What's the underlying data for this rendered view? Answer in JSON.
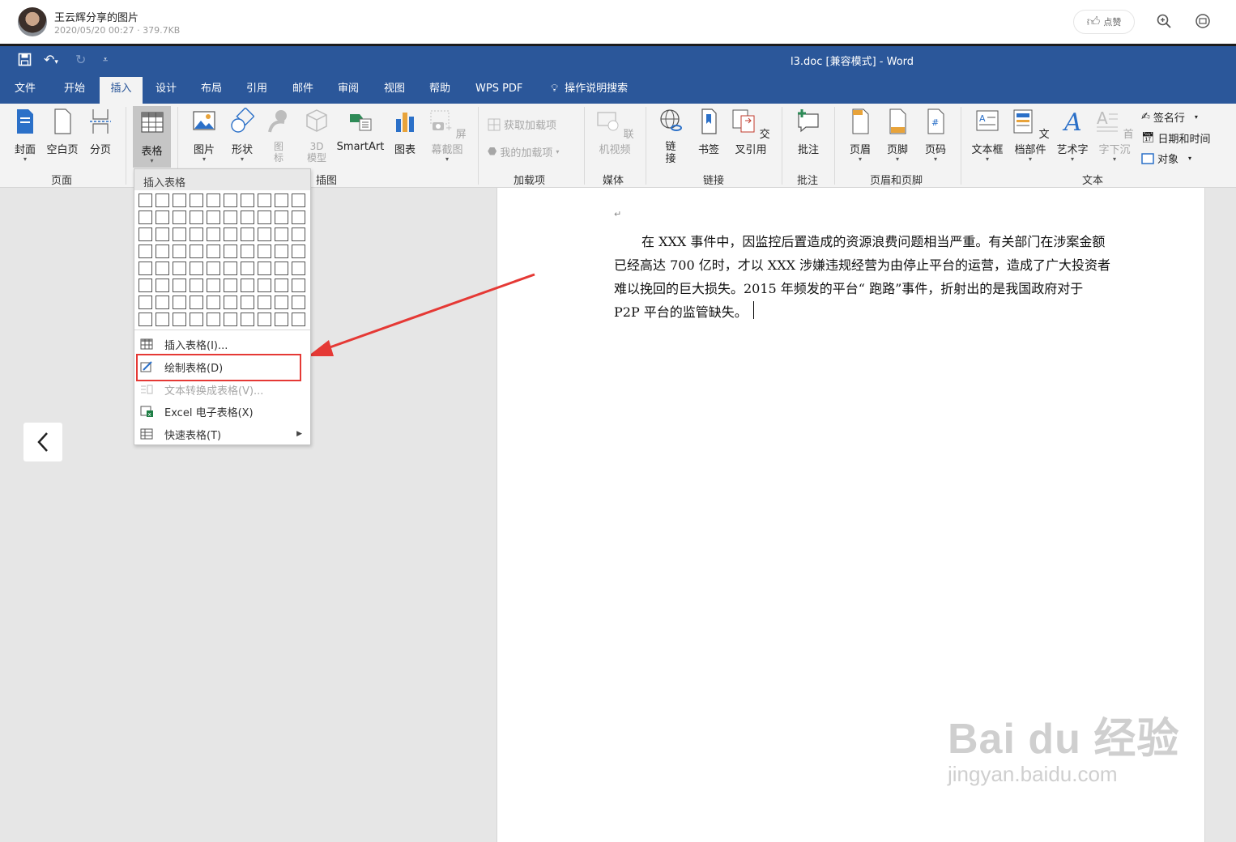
{
  "viewer": {
    "sharer_name": "王云辉分享的图片",
    "meta": "2020/05/20 00:27 · 379.7KB",
    "like_label": "点赞"
  },
  "word": {
    "title": "l3.doc [兼容模式]  -  Word",
    "tabs": [
      "文件",
      "开始",
      "插入",
      "设计",
      "布局",
      "引用",
      "邮件",
      "审阅",
      "视图",
      "帮助",
      "WPS PDF",
      "操作说明搜索"
    ],
    "active_tab": "插入",
    "ribbon": {
      "pages": {
        "cover": "封面",
        "blank": "空白页",
        "break": "分页",
        "group": "页面"
      },
      "tables": {
        "table": "表格"
      },
      "illustrations": {
        "picture": "图片",
        "shapes": "形状",
        "icons": "图标",
        "models": "3D模型",
        "smartart": "SmartArt",
        "chart": "图表",
        "screenshot": "屏幕截图",
        "group": "插图"
      },
      "addins": {
        "get": "获取加载项",
        "my": "我的加载项",
        "group": "加载项"
      },
      "media": {
        "video": "联机视频",
        "group": "媒体"
      },
      "links": {
        "link": "链接",
        "bookmark": "书签",
        "crossref": "交叉引用",
        "group": "链接"
      },
      "comments": {
        "comment": "批注",
        "group": "批注"
      },
      "header_footer": {
        "header": "页眉",
        "footer": "页脚",
        "page_number": "页码",
        "group": "页眉和页脚"
      },
      "text": {
        "textbox": "文本框",
        "quickparts": "文档部件",
        "wordart": "艺术字",
        "dropcap": "首字下沉",
        "signature": "签名行",
        "datetime": "日期和时间",
        "object": "对象",
        "group": "文本"
      }
    },
    "table_menu": {
      "header": "插入表格",
      "grid_cols": 10,
      "grid_rows": 8,
      "items": [
        "插入表格(I)...",
        "绘制表格(D)",
        "文本转换成表格(V)...",
        "Excel 电子表格(X)",
        "快速表格(T)"
      ]
    },
    "document": {
      "paragraph_lines": [
        "在 XXX 事件中，因监控后置造成的资源浪费问题相当严重。有关部门在涉案金额",
        "已经高达 700 亿时，才以 XXX 涉嫌违规经营为由停止平台的运营，造成了广大投资者",
        "难以挽回的巨大损失。2015 年频发的平台“ 跑路”事件，折射出的是我国政府对于",
        "P2P 平台的监管缺失。"
      ],
      "paragraph_mark": "↵"
    }
  },
  "watermark": {
    "brand": "Bai du 经验",
    "url": "jingyan.baidu.com"
  },
  "colors": {
    "word_blue": "#2b579a",
    "ribbon_bg": "#f3f3f3",
    "highlight": "#e53935"
  }
}
